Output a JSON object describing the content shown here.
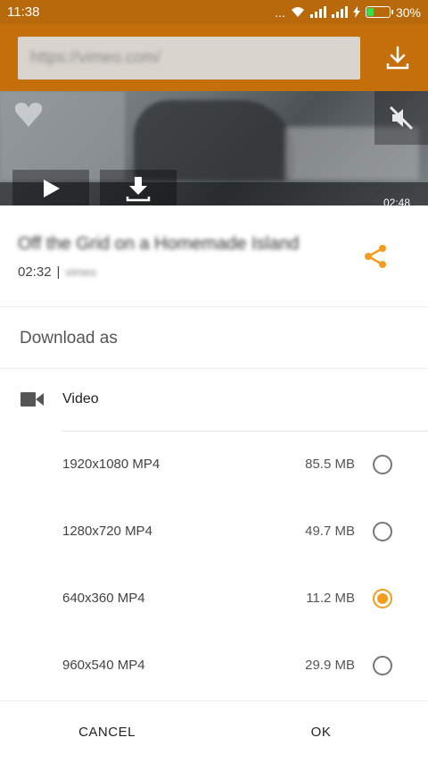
{
  "status_bar": {
    "time": "11:38",
    "dots": "...",
    "battery_pct": "30%",
    "battery_level": 0.3
  },
  "toolbar": {
    "url": "https://vimeo.com/",
    "download_icon": "download-icon"
  },
  "video": {
    "duration": "02:48",
    "play_icon": "play-icon",
    "download_icon": "download-icon",
    "mute_icon": "mute-icon"
  },
  "dialog": {
    "video_title": "Off the Grid on a Homemade Island",
    "length": "02:32",
    "separator": "|",
    "source": "vimeo",
    "share_icon": "share-icon",
    "download_as": "Download as",
    "category": {
      "icon": "videocam-icon",
      "label": "Video"
    },
    "options": [
      {
        "resolution": "1920x1080 MP4",
        "size": "85.5 MB",
        "selected": false
      },
      {
        "resolution": "1280x720 MP4",
        "size": "49.7 MB",
        "selected": false
      },
      {
        "resolution": "640x360 MP4",
        "size": "11.2 MB",
        "selected": true
      },
      {
        "resolution": "960x540 MP4",
        "size": "29.9 MB",
        "selected": false
      }
    ],
    "cancel_label": "CANCEL",
    "ok_label": "OK"
  },
  "colors": {
    "accent": "#f39c1f",
    "toolbar": "#c46f0a",
    "statusbar": "#b8690b"
  }
}
